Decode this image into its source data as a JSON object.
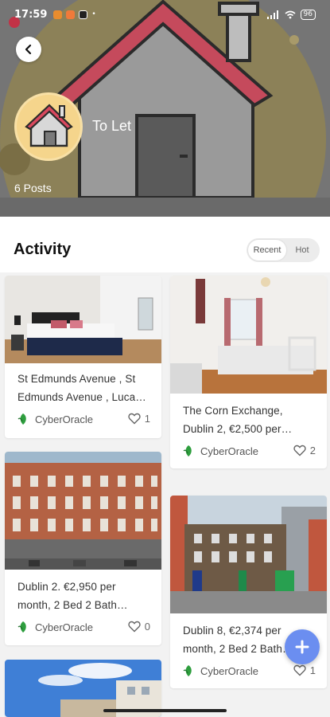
{
  "status_bar": {
    "time": "17:59",
    "battery": "96"
  },
  "topic": {
    "title": "To Let",
    "posts": "6 Posts"
  },
  "activity": {
    "title": "Activity",
    "tabs": [
      "Recent",
      "Hot"
    ],
    "selected_tab": "Recent"
  },
  "posts": [
    {
      "text_line1": "St Edmunds Avenue , St",
      "text_line2": "Edmunds Avenue , Luca…",
      "author": "CyberOracle",
      "likes": "1"
    },
    {
      "text_line1": "The Corn Exchange,",
      "text_line2": "Dublin 2, €2,500 per…",
      "author": "CyberOracle",
      "likes": "2"
    },
    {
      "text_line1": "Dublin 2. €2,950 per",
      "text_line2": "month, 2 Bed 2 Bath…",
      "author": "CyberOracle",
      "likes": "0"
    },
    {
      "text_line1": "Dublin 8, €2,374 per",
      "text_line2": "month, 2 Bed 2 Bath…",
      "author": "CyberOracle",
      "likes": "1"
    }
  ],
  "icons": {
    "back": "chevron-left-icon",
    "author": "leaf-avatar-icon",
    "like": "heart-icon",
    "fab": "plus-icon"
  },
  "colors": {
    "accent": "#6b8ef0",
    "roof": "#d9485e",
    "avatar_bg": "#f5d58c",
    "leaf": "#2e9e3e"
  }
}
